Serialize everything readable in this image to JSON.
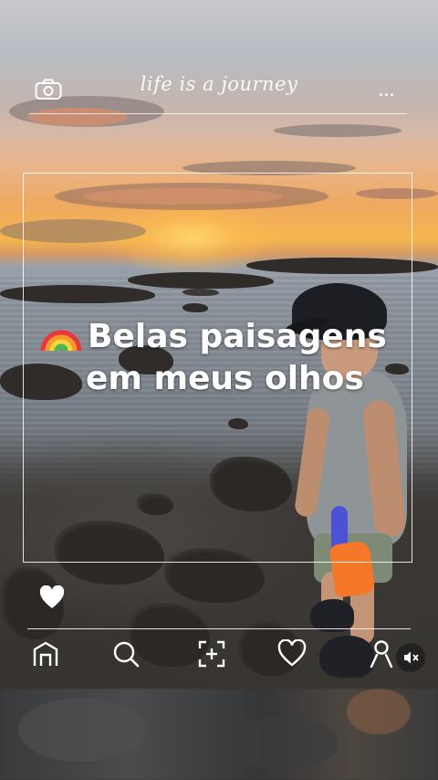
{
  "overlay": {
    "caption_top": "life is a journey",
    "menu": "...",
    "headline_line1": "Belas paisagens",
    "headline_line2": "em meus olhos"
  },
  "icons": {
    "top_left": "camera-icon",
    "top_right": "more-dots-icon",
    "headline": "rainbow-emoji",
    "like": "heart-filled-icon",
    "nav": [
      "home-icon",
      "search-icon",
      "add-photo-icon",
      "heart-outline-icon",
      "profile-icon"
    ],
    "sound": "mute-icon"
  },
  "colors": {
    "overlay_text": "#ffffff",
    "sunset_orange": "#f5b64e",
    "cap": "#1c1e24",
    "water_gun_blue": "#4b52d6",
    "water_gun_orange": "#f5782a"
  }
}
